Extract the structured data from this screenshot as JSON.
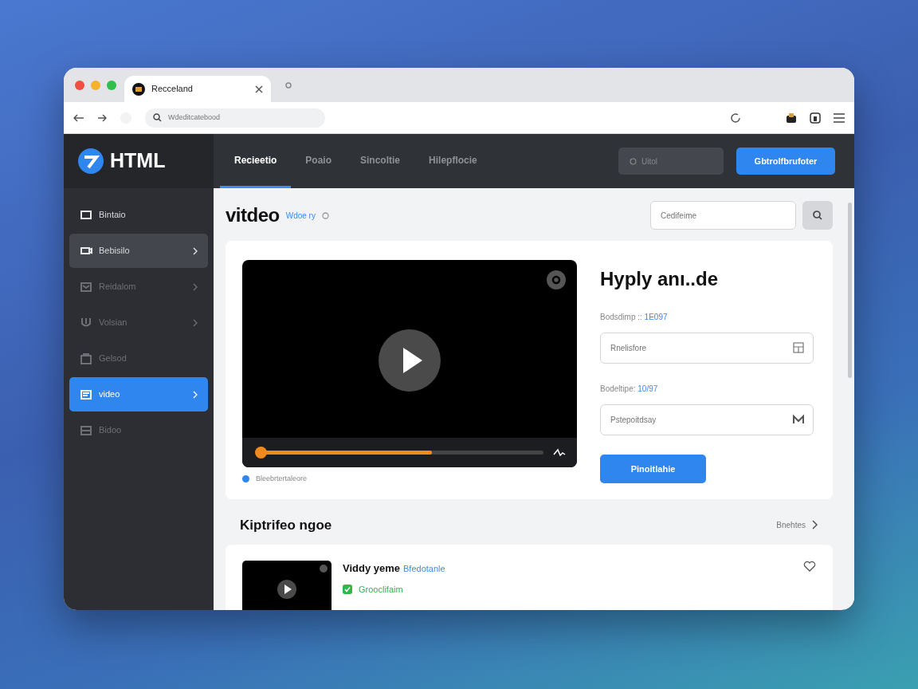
{
  "browser": {
    "tab_title": "Recceland",
    "address": "Wdeditcatebood"
  },
  "header": {
    "logo": "HTML",
    "tabs": [
      {
        "label": "Recieetio",
        "selected": true
      },
      {
        "label": "Poaio",
        "selected": false
      },
      {
        "label": "Sincoltie",
        "selected": false
      },
      {
        "label": "Hilepflocie",
        "selected": false
      }
    ],
    "search": {
      "placeholder": "Uitol"
    },
    "button": "Gbtrolfbrufoter"
  },
  "sidebar": {
    "items": [
      {
        "label": "Bintaio",
        "selected": false,
        "hovered": false,
        "disabled": false,
        "chevron": false
      },
      {
        "label": "Bebisilo",
        "selected": false,
        "hovered": true,
        "disabled": false,
        "chevron": true
      },
      {
        "label": "Reidalom",
        "selected": false,
        "hovered": false,
        "disabled": true,
        "chevron": true
      },
      {
        "label": "Volsian",
        "selected": false,
        "hovered": false,
        "disabled": true,
        "chevron": true
      },
      {
        "label": "Gelsod",
        "selected": false,
        "hovered": false,
        "disabled": true,
        "chevron": false
      },
      {
        "label": "video",
        "selected": true,
        "hovered": false,
        "disabled": false,
        "chevron": true
      },
      {
        "label": "Bidoo",
        "selected": false,
        "hovered": false,
        "disabled": true,
        "chevron": false
      }
    ]
  },
  "page": {
    "title": "vitdeo",
    "subtitle": "Wdoe ry",
    "search": {
      "placeholder": "Cedifeime"
    }
  },
  "player": {
    "level": 0.6,
    "caption": "Bleebrtertaleore"
  },
  "details": {
    "title": "Hyply anı..de",
    "fields": [
      {
        "label": "Bodsdimp ::",
        "value": "1E097",
        "placeholder": "Rnelisfore",
        "kind": "grid"
      },
      {
        "label": "Bodeltipe:",
        "value": "10/97",
        "placeholder": "Pstepoitdsay",
        "kind": "chevron"
      }
    ],
    "button": "Pinoitlahie"
  },
  "section": {
    "title": "Kiptrifeo ngoe",
    "link": "Bnehtes",
    "items": [
      {
        "title": "Viddy yeme",
        "link": "Bfedotanle",
        "status": "Grooclifaim"
      }
    ]
  }
}
